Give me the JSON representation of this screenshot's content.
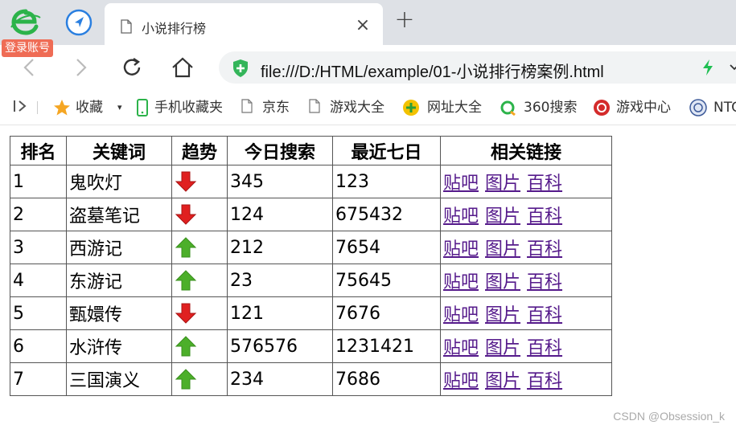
{
  "browser": {
    "login_badge": "登录账号",
    "tab": {
      "title": "小说排行榜",
      "close": "×"
    },
    "new_tab": "+",
    "address": {
      "url": "file:///D:/HTML/example/01-小说排行榜案例.html"
    }
  },
  "bookmarks": [
    {
      "label": "收藏",
      "icon": "star-icon"
    },
    {
      "label": "手机收藏夹",
      "icon": "phone-icon"
    },
    {
      "label": "京东",
      "icon": "page-icon"
    },
    {
      "label": "游戏大全",
      "icon": "page-icon"
    },
    {
      "label": "网址大全",
      "icon": "plus-circle-icon"
    },
    {
      "label": "360搜索",
      "icon": "search-360-icon"
    },
    {
      "label": "游戏中心",
      "icon": "game-center-icon"
    },
    {
      "label": "NTC",
      "icon": "globe-icon"
    }
  ],
  "table": {
    "headers": [
      "排名",
      "关键词",
      "趋势",
      "今日搜索",
      "最近七日",
      "相关链接"
    ],
    "rows": [
      {
        "rank": "1",
        "keyword": "鬼吹灯",
        "trend": "down",
        "today": "345",
        "week": "123"
      },
      {
        "rank": "2",
        "keyword": "盗墓笔记",
        "trend": "down",
        "today": "124",
        "week": "675432"
      },
      {
        "rank": "3",
        "keyword": "西游记",
        "trend": "up",
        "today": "212",
        "week": "7654"
      },
      {
        "rank": "4",
        "keyword": "东游记",
        "trend": "up",
        "today": "23",
        "week": "75645"
      },
      {
        "rank": "5",
        "keyword": "甄嬛传",
        "trend": "down",
        "today": "121",
        "week": "7676"
      },
      {
        "rank": "6",
        "keyword": "水浒传",
        "trend": "up",
        "today": "576576",
        "week": "1231421"
      },
      {
        "rank": "7",
        "keyword": "三国演义",
        "trend": "up",
        "today": "234",
        "week": "7686"
      }
    ],
    "links": [
      "贴吧",
      "图片",
      "百科"
    ]
  },
  "watermark": "CSDN @Obsession_k",
  "colors": {
    "up": "#4caf2a",
    "down": "#e02020",
    "link": "#551a8b",
    "tabstrip": "#dee1e6"
  }
}
